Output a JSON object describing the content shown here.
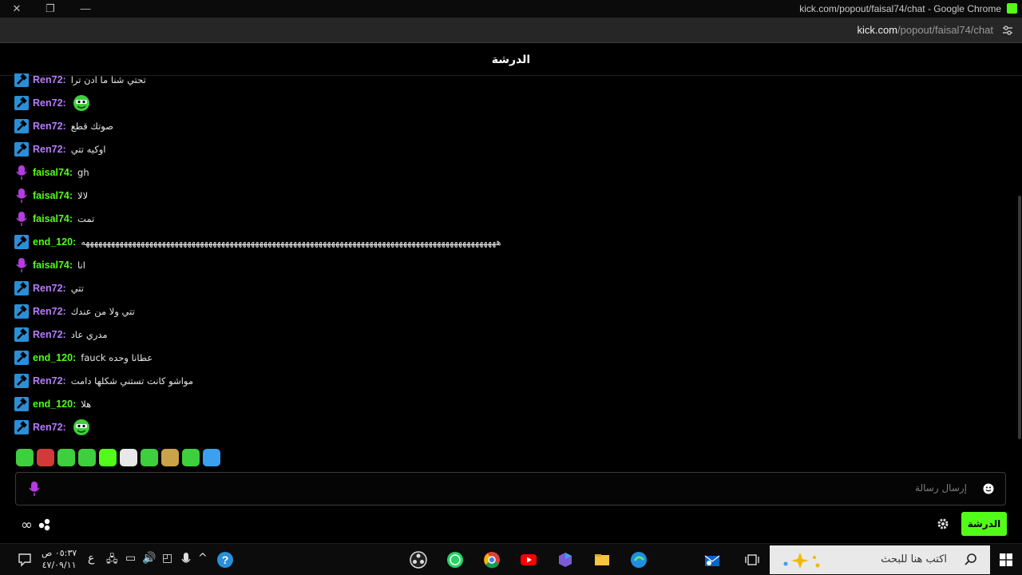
{
  "window": {
    "title": "kick.com/popout/faisal74/chat - Google Chrome",
    "url_host": "kick.com",
    "url_path": "/popout/faisal74/chat"
  },
  "chat": {
    "header": "الدرشة",
    "messages": [
      {
        "user": "Ren72",
        "badge": "mod",
        "color": "#b77cff",
        "text": "تحتي شنا ما ادن ترا"
      },
      {
        "user": "Ren72",
        "badge": "mod",
        "color": "#b77cff",
        "text": "",
        "emote": "green-face-emote"
      },
      {
        "user": "Ren72",
        "badge": "mod",
        "color": "#b77cff",
        "text": "صوتك قطع"
      },
      {
        "user": "Ren72",
        "badge": "mod",
        "color": "#b77cff",
        "text": "اوكيه تتي"
      },
      {
        "user": "faisal74",
        "badge": "mic",
        "color": "#53fc18",
        "text": "gh"
      },
      {
        "user": "faisal74",
        "badge": "mic",
        "color": "#53fc18",
        "text": "لالا"
      },
      {
        "user": "faisal74",
        "badge": "mic",
        "color": "#53fc18",
        "text": "تمت"
      },
      {
        "user": "end_120",
        "badge": "mod",
        "color": "#53fc18",
        "text": "ههههههههههههههههههههههههههههههههههههههههههههههههههههههههههههههههههههههههههههههههههههههههههههههههههه"
      },
      {
        "user": "faisal74",
        "badge": "mic",
        "color": "#53fc18",
        "text": "انا"
      },
      {
        "user": "Ren72",
        "badge": "mod",
        "color": "#b77cff",
        "text": "تتي"
      },
      {
        "user": "Ren72",
        "badge": "mod",
        "color": "#b77cff",
        "text": "تتي ولا من عندك"
      },
      {
        "user": "Ren72",
        "badge": "mod",
        "color": "#b77cff",
        "text": "مدري عاد"
      },
      {
        "user": "end_120",
        "badge": "mod",
        "color": "#53fc18",
        "text": "fauck عطانا وحده"
      },
      {
        "user": "Ren72",
        "badge": "mod",
        "color": "#b77cff",
        "text": "مواشو كانت تستني شكلها دامت"
      },
      {
        "user": "end_120",
        "badge": "mod",
        "color": "#53fc18",
        "text": "هلا"
      },
      {
        "user": "Ren72",
        "badge": "mod",
        "color": "#b77cff",
        "text": "",
        "emote": "green-face-emote"
      }
    ],
    "emote_bar": [
      "emote-1",
      "emote-2",
      "emote-3",
      "emote-4",
      "emote-5",
      "emote-6",
      "emote-7",
      "emote-8",
      "emote-9",
      "emote-10"
    ],
    "input_placeholder": "إرسال رسالة",
    "send_button": "الدرشة",
    "infinity_label": "∞"
  },
  "taskbar": {
    "search_placeholder": "اكتب هنا للبحث",
    "time": "٠٥:٣٧ ص",
    "date": "٤٧/٠٩/١١",
    "lang": "ع"
  },
  "colors": {
    "accent": "#53fc18",
    "mod_badge": "#2a8fd6",
    "mic_badge": "#b63be0"
  }
}
